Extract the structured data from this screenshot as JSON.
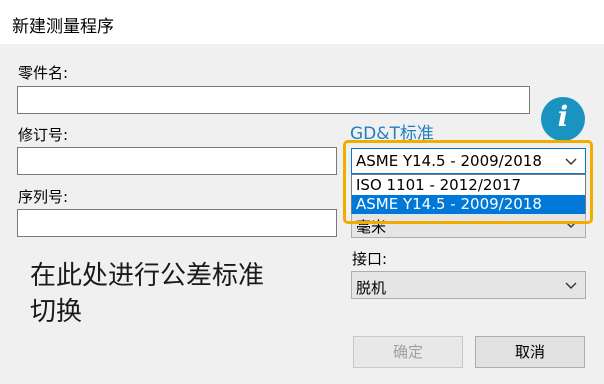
{
  "dialog": {
    "title": "新建测量程序"
  },
  "part_name": {
    "label": "零件名:",
    "value": ""
  },
  "revision": {
    "label": "修订号:",
    "value": ""
  },
  "serial": {
    "label": "序列号:",
    "value": ""
  },
  "gdt": {
    "label": "GD&T标准",
    "selected": "ASME Y14.5 - 2009/2018",
    "options": [
      "ISO 1101 - 2012/2017",
      "ASME Y14.5 - 2009/2018"
    ],
    "highlighted_option_index": 1
  },
  "units": {
    "partial_value": "毫米"
  },
  "interface": {
    "label": "接口:",
    "value": "脱机"
  },
  "info_icon": {
    "glyph": "i"
  },
  "annotation": {
    "line1": "在此处进行公差标准",
    "line2": "切换",
    "color": "#1a1a1a"
  },
  "buttons": {
    "ok": "确定",
    "cancel": "取消"
  },
  "colors": {
    "accent": "#0078d7",
    "highlight": "#f0ad00",
    "info": "#1a93c0",
    "gdt_label": "#1e7fc4"
  }
}
